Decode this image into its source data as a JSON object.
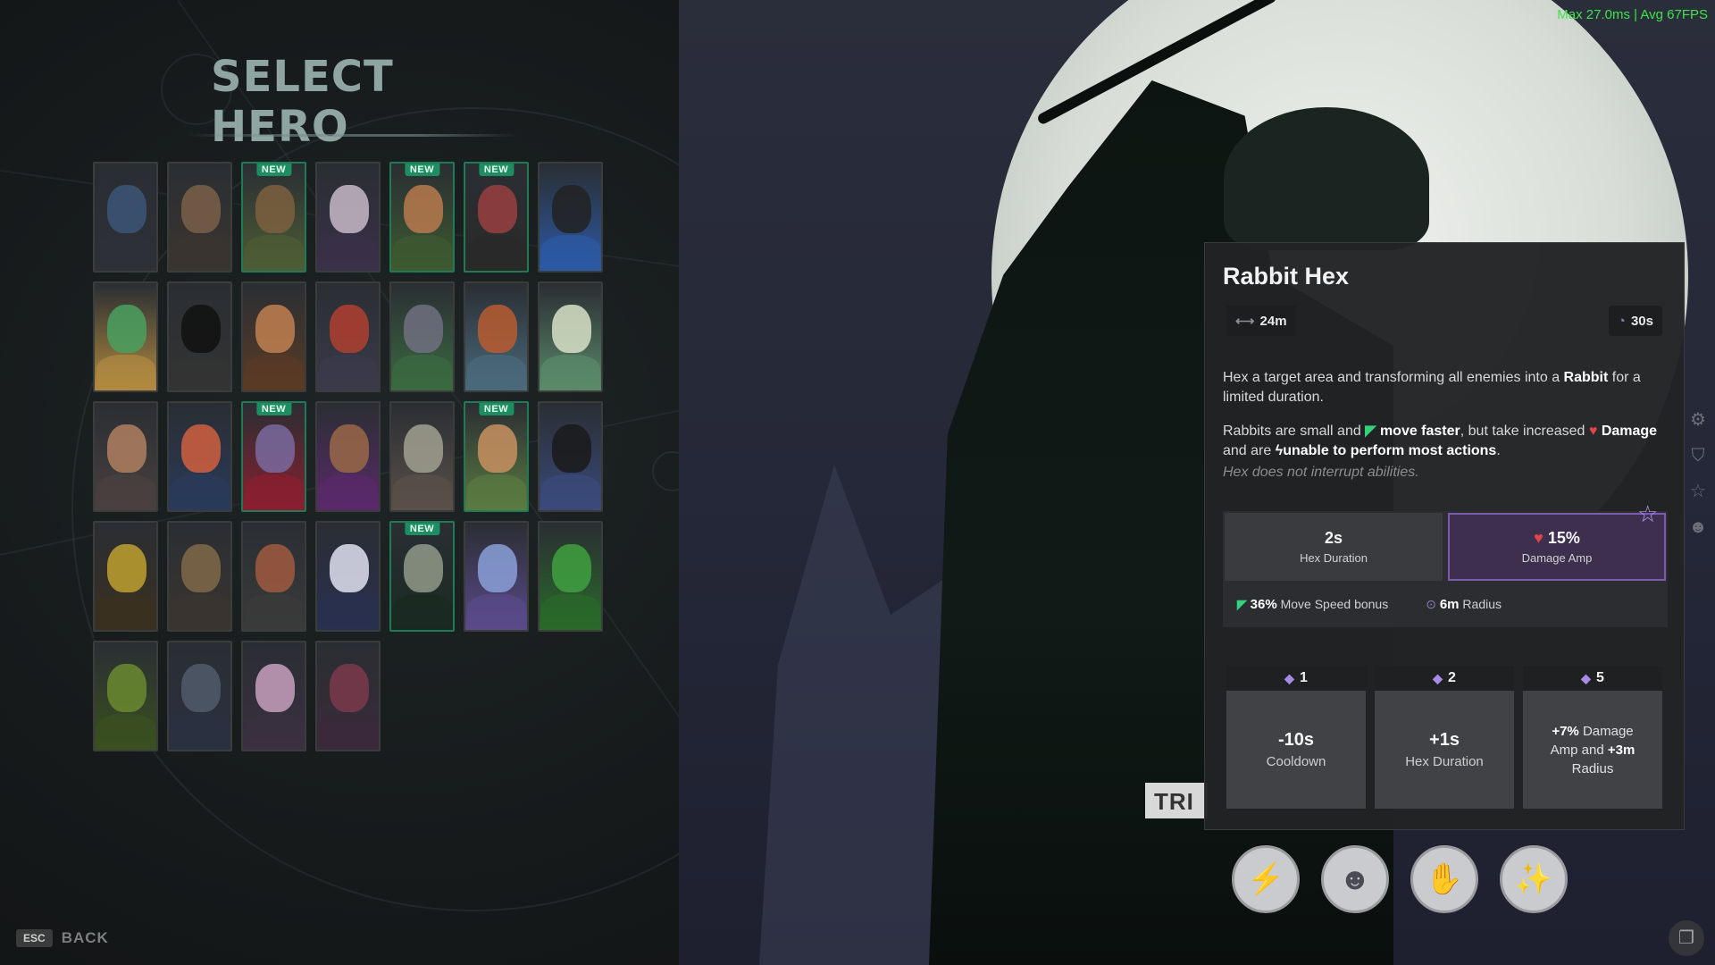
{
  "fps": "Max  27.0ms | Avg   67FPS",
  "title": "SELECT HERO",
  "back": {
    "key": "ESC",
    "label": "BACK"
  },
  "new_label": "NEW",
  "heroes": [
    {
      "is_new": false,
      "skin": "#3b5677",
      "body": "#2d3038"
    },
    {
      "is_new": false,
      "skin": "#7a6048",
      "body": "#3b3530"
    },
    {
      "is_new": true,
      "skin": "#7d6040",
      "body": "#4d5d35"
    },
    {
      "is_new": false,
      "skin": "#c8b8c8",
      "body": "#3a3048"
    },
    {
      "is_new": true,
      "skin": "#b97a4e",
      "body": "#3d5a30"
    },
    {
      "is_new": true,
      "skin": "#9a4040",
      "body": "#2a2a2a"
    },
    {
      "is_new": false,
      "skin": "#222222",
      "body": "#2c5aa5"
    },
    {
      "is_new": false,
      "skin": "#4aa060",
      "body": "#b08a40"
    },
    {
      "is_new": false,
      "skin": "#111111",
      "body": "#333333"
    },
    {
      "is_new": false,
      "skin": "#c08050",
      "body": "#5a3b25"
    },
    {
      "is_new": false,
      "skin": "#b04030",
      "body": "#3a3a4a"
    },
    {
      "is_new": false,
      "skin": "#707080",
      "body": "#3b6a40"
    },
    {
      "is_new": false,
      "skin": "#b85c30",
      "body": "#4a6a7a"
    },
    {
      "is_new": false,
      "skin": "#d8e0c8",
      "body": "#5a8a6a"
    },
    {
      "is_new": false,
      "skin": "#b08060",
      "body": "#4a4040"
    },
    {
      "is_new": false,
      "skin": "#d06040",
      "body": "#2a3a5a"
    },
    {
      "is_new": true,
      "skin": "#7a6aa0",
      "body": "#8a2030"
    },
    {
      "is_new": false,
      "skin": "#9a6848",
      "body": "#5a2a6a"
    },
    {
      "is_new": false,
      "skin": "#a0a090",
      "body": "#5a5048"
    },
    {
      "is_new": true,
      "skin": "#c89060",
      "body": "#5a7a40"
    },
    {
      "is_new": false,
      "skin": "#1a1a1a",
      "body": "#3a4a7a"
    },
    {
      "is_new": false,
      "skin": "#c0a030",
      "body": "#3a3020"
    },
    {
      "is_new": false,
      "skin": "#806848",
      "body": "#3a3530"
    },
    {
      "is_new": false,
      "skin": "#a05a40",
      "body": "#3a3a3a"
    },
    {
      "is_new": false,
      "skin": "#e0e0f0",
      "body": "#2a3050"
    },
    {
      "is_new": true,
      "skin": "#909a88",
      "body": "#1a2a22"
    },
    {
      "is_new": false,
      "skin": "#8aa0d8",
      "body": "#5a4a8a"
    },
    {
      "is_new": false,
      "skin": "#40a040",
      "body": "#2a6a2a"
    },
    {
      "is_new": false,
      "skin": "#6a8a30",
      "body": "#3a5020"
    },
    {
      "is_new": false,
      "skin": "#505a6a",
      "body": "#2a3040"
    },
    {
      "is_new": false,
      "skin": "#c8a0c0",
      "body": "#3a3040"
    },
    {
      "is_new": false,
      "skin": "#7a3a4a",
      "body": "#3a2a3a"
    }
  ],
  "ability": {
    "name": "Rabbit Hex",
    "range": "24m",
    "cooldown": "30s",
    "desc1_a": "Hex a target area and transforming all enemies into a ",
    "desc1_b": "Rabbit",
    "desc1_c": " for a limited duration.",
    "desc2_a": "Rabbits are small and ",
    "desc2_b": "move faster",
    "desc2_c": ", but take increased ",
    "desc2_d": "Damage",
    "desc2_e": " and are ",
    "desc2_f": "unable to perform most actions",
    "desc2_g": ".",
    "note": "Hex does not interrupt abilities.",
    "stat1_val": "2s",
    "stat1_lbl": "Hex Duration",
    "stat2_val": "15%",
    "stat2_lbl": "Damage Amp",
    "sub1_val": "36%",
    "sub1_lbl": "Move Speed bonus",
    "sub2_val": "6m",
    "sub2_lbl": "Radius",
    "upgrades": [
      {
        "tier": "1",
        "val": "-10s",
        "lbl": "Cooldown"
      },
      {
        "tier": "2",
        "val": "+1s",
        "lbl": "Hex Duration"
      },
      {
        "tier": "5",
        "l1_a": "+7%",
        "l1_b": " Damage",
        "l2_a": "Amp and ",
        "l2_b": "+3m",
        "l3": "Radius"
      }
    ]
  },
  "colors": {
    "accent_green": "#1d8e61",
    "accent_purple": "#7c5ab0",
    "fps_green": "#3fe44a"
  }
}
